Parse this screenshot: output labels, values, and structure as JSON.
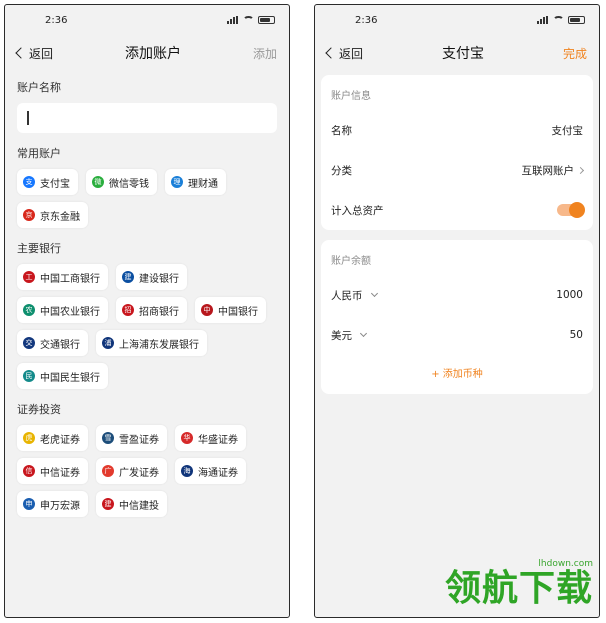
{
  "left": {
    "time": "2:36",
    "nav": {
      "back": "返回",
      "title": "添加账户",
      "action": "添加"
    },
    "name_section": "账户名称",
    "sections": [
      {
        "title": "常用账户",
        "items": [
          {
            "label": "支付宝",
            "icon": "alipay-icon",
            "color": "#1677ff",
            "glyph": "支"
          },
          {
            "label": "微信零钱",
            "icon": "wechat-icon",
            "color": "#2aae3e",
            "glyph": "微"
          },
          {
            "label": "理财通",
            "icon": "licaitong-icon",
            "color": "#1a7fd8",
            "glyph": "理"
          },
          {
            "label": "京东金融",
            "icon": "jd-finance-icon",
            "color": "#d8281b",
            "glyph": "京"
          }
        ]
      },
      {
        "title": "主要银行",
        "items": [
          {
            "label": "中国工商银行",
            "icon": "icbc-icon",
            "color": "#c8161d",
            "glyph": "工"
          },
          {
            "label": "建设银行",
            "icon": "ccb-icon",
            "color": "#0b4fa1",
            "glyph": "建"
          },
          {
            "label": "中国农业银行",
            "icon": "abc-icon",
            "color": "#0e8f6e",
            "glyph": "农"
          },
          {
            "label": "招商银行",
            "icon": "cmb-icon",
            "color": "#c8161d",
            "glyph": "招"
          },
          {
            "label": "中国银行",
            "icon": "boc-icon",
            "color": "#b7171d",
            "glyph": "中"
          },
          {
            "label": "交通银行",
            "icon": "bocom-icon",
            "color": "#13387d",
            "glyph": "交"
          },
          {
            "label": "上海浦东发展银行",
            "icon": "spdb-icon",
            "color": "#10357a",
            "glyph": "浦"
          },
          {
            "label": "中国民生银行",
            "icon": "cmbc-icon",
            "color": "#138a8a",
            "glyph": "民"
          }
        ]
      },
      {
        "title": "证券投资",
        "items": [
          {
            "label": "老虎证券",
            "icon": "tiger-icon",
            "color": "#e8b400",
            "glyph": "虎"
          },
          {
            "label": "雪盈证券",
            "icon": "snowball-icon",
            "color": "#1c4d7a",
            "glyph": "雪"
          },
          {
            "label": "华盛证券",
            "icon": "huasheng-icon",
            "color": "#d62a2a",
            "glyph": "华"
          },
          {
            "label": "中信证券",
            "icon": "citic-icon",
            "color": "#c8161d",
            "glyph": "信"
          },
          {
            "label": "广发证券",
            "icon": "gf-icon",
            "color": "#e23a2d",
            "glyph": "广"
          },
          {
            "label": "海通证券",
            "icon": "haitong-icon",
            "color": "#10357a",
            "glyph": "海"
          },
          {
            "label": "申万宏源",
            "icon": "swhy-icon",
            "color": "#1a5eb0",
            "glyph": "申"
          },
          {
            "label": "中信建投",
            "icon": "csc-icon",
            "color": "#c8161d",
            "glyph": "建"
          }
        ]
      }
    ]
  },
  "right": {
    "time": "2:36",
    "nav": {
      "back": "返回",
      "title": "支付宝",
      "action": "完成"
    },
    "info": {
      "header": "账户信息",
      "name_label": "名称",
      "name_value": "支付宝",
      "category_label": "分类",
      "category_value": "互联网账户",
      "include_label": "计入总资产",
      "include_on": true
    },
    "balance": {
      "header": "账户余额",
      "rows": [
        {
          "currency": "人民币",
          "amount": "1000"
        },
        {
          "currency": "美元",
          "amount": "50"
        }
      ],
      "add_label": "+ 添加币种"
    }
  },
  "watermark": {
    "url": "lhdown.com",
    "text": "领航下载"
  },
  "accent": "#f0831f"
}
